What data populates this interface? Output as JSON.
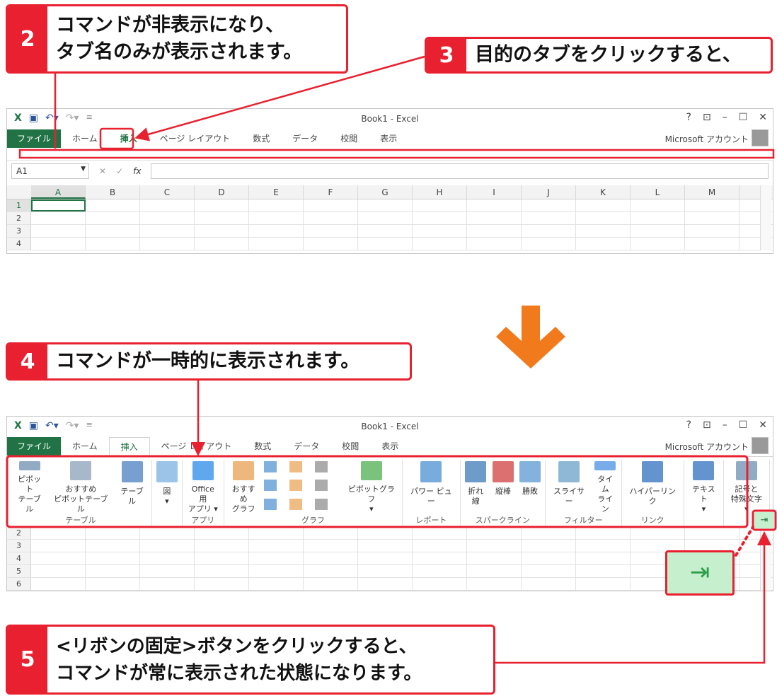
{
  "callouts": [
    {
      "num": "2",
      "lines": [
        "コマンドが非表示になり、",
        "タブ名のみが表示されます。"
      ]
    },
    {
      "num": "3",
      "lines": [
        "目的のタブをクリックすると、"
      ]
    },
    {
      "num": "4",
      "lines": [
        "コマンドが一時的に表示されます。"
      ]
    },
    {
      "num": "5",
      "lines": [
        "<リボンの固定>ボタンをクリックすると、",
        "コマンドが常に表示された状態になります。"
      ]
    }
  ],
  "window": {
    "title": "Book1 - Excel",
    "controls": [
      "?",
      "⊡",
      "–",
      "☐",
      "✕"
    ],
    "tabs": [
      "ファイル",
      "ホーム",
      "挿入",
      "ページ レイアウト",
      "数式",
      "データ",
      "校閲",
      "表示"
    ],
    "active_tab": "挿入",
    "account": "Microsoft アカウント",
    "namebox": "A1",
    "fx": "fx",
    "columns": [
      "A",
      "B",
      "C",
      "D",
      "E",
      "F",
      "G",
      "H",
      "I",
      "J",
      "K",
      "L",
      "M"
    ],
    "rows_top": [
      "1",
      "2",
      "3",
      "4"
    ],
    "rows_bottom": [
      "2",
      "3",
      "4",
      "5",
      "6"
    ]
  },
  "ribbon": {
    "groups": [
      {
        "label": "テーブル",
        "buttons": [
          "ピボット\nテーブル",
          "おすすめ\nピボットテーブル",
          "テーブル"
        ]
      },
      {
        "label": "",
        "buttons": [
          "図\n▾"
        ]
      },
      {
        "label": "アプリ",
        "buttons": [
          "Office 用\nアプリ ▾"
        ]
      },
      {
        "label": "グラフ",
        "buttons": [
          "おすすめ\nグラフ",
          "ピボットグラフ\n▾"
        ]
      },
      {
        "label": "レポート",
        "buttons": [
          "パワー ビュー"
        ]
      },
      {
        "label": "スパークライン",
        "buttons": [
          "折れ線",
          "縦棒",
          "勝敗"
        ]
      },
      {
        "label": "フィルター",
        "buttons": [
          "スライサー",
          "タイム\nライン"
        ]
      },
      {
        "label": "リンク",
        "buttons": [
          "ハイパーリンク"
        ]
      },
      {
        "label": "",
        "buttons": [
          "テキスト\n▾"
        ]
      },
      {
        "label": "",
        "buttons": [
          "記号と\n特殊文字 ▾"
        ]
      }
    ],
    "pin_button": "pin-ribbon"
  },
  "colors": {
    "accent_red": "#e8202f",
    "excel_green": "#217346",
    "arrow_orange": "#f07a1c",
    "pin_bg": "#c6efce"
  }
}
